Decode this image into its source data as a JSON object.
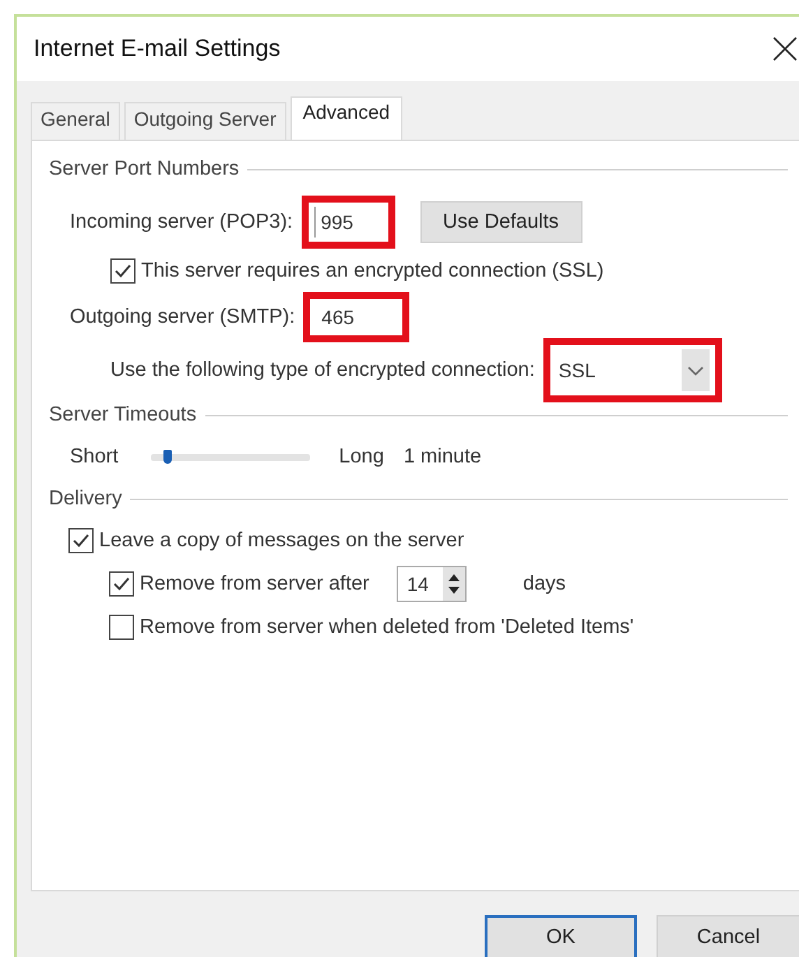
{
  "window": {
    "title": "Internet E-mail Settings"
  },
  "tabs": [
    {
      "label": "General",
      "selected": false
    },
    {
      "label": "Outgoing Server",
      "selected": false
    },
    {
      "label": "Advanced",
      "selected": true
    }
  ],
  "server_port_numbers": {
    "heading": "Server Port Numbers",
    "incoming": {
      "label": "Incoming server (POP3):",
      "value": "995",
      "highlighted": true
    },
    "use_defaults_button": "Use Defaults",
    "ssl_checkbox": {
      "label": "This server requires an encrypted connection (SSL)",
      "checked": true
    },
    "outgoing": {
      "label": "Outgoing server (SMTP):",
      "value": "465",
      "highlighted": true
    },
    "encryption": {
      "label": "Use the following type of encrypted connection:",
      "value": "SSL",
      "highlighted": true
    }
  },
  "server_timeouts": {
    "heading": "Server Timeouts",
    "min_label": "Short",
    "max_label": "Long",
    "level": 0.08,
    "reading": "1 minute"
  },
  "delivery": {
    "heading": "Delivery",
    "options": [
      {
        "label": "Leave a copy of messages on the server",
        "checked": true,
        "children": [
          {
            "label": "Remove from server after",
            "checked": true,
            "spinner": {
              "value": "14",
              "unit": "days"
            }
          },
          {
            "label": "Remove from server when deleted from 'Deleted Items'",
            "checked": false
          }
        ]
      }
    ]
  },
  "buttons": [
    {
      "label": "OK",
      "default": true
    },
    {
      "label": "Cancel",
      "default": false
    }
  ]
}
